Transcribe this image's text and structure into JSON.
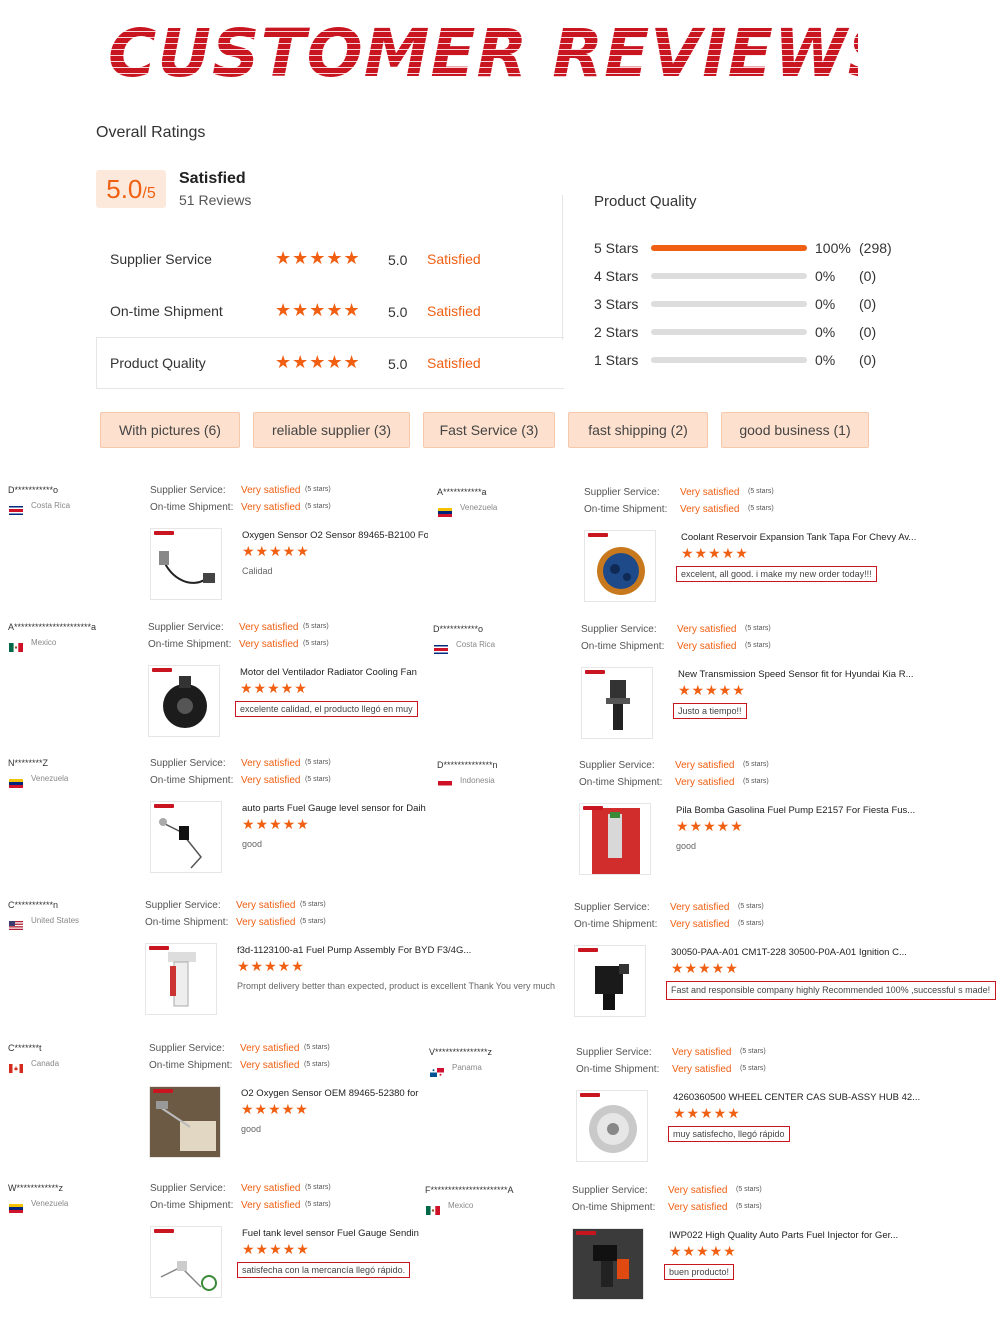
{
  "banner": "CUSTOMER REVIEWS",
  "overall": {
    "title": "Overall Ratings",
    "score_big": "5.0",
    "score_small": "/5",
    "label": "Satisfied",
    "reviews": "51 Reviews"
  },
  "ratings": [
    {
      "label": "Supplier Service",
      "stars": "★★★★★",
      "score": "5.0",
      "word": "Satisfied"
    },
    {
      "label": "On-time Shipment",
      "stars": "★★★★★",
      "score": "5.0",
      "word": "Satisfied"
    },
    {
      "label": "Product Quality",
      "stars": "★★★★★",
      "score": "5.0",
      "word": "Satisfied"
    }
  ],
  "product_quality": {
    "title": "Product Quality",
    "rows": [
      {
        "label": "5 Stars",
        "fraction": 1.0,
        "pct": "100%",
        "count": "(298)"
      },
      {
        "label": "4 Stars",
        "fraction": 0,
        "pct": "0%",
        "count": "(0)"
      },
      {
        "label": "3 Stars",
        "fraction": 0,
        "pct": "0%",
        "count": "(0)"
      },
      {
        "label": "2 Stars",
        "fraction": 0,
        "pct": "0%",
        "count": "(0)"
      },
      {
        "label": "1 Stars",
        "fraction": 0,
        "pct": "0%",
        "count": "(0)"
      }
    ]
  },
  "tags": [
    "With pictures (6)",
    "reliable supplier (3)",
    "Fast Service (3)",
    "fast shipping (2)",
    "good business (1)"
  ],
  "review_common": {
    "supplier_label": "Supplier Service:",
    "shipment_label": "On-time Shipment:",
    "very_satisfied": "Very satisfied",
    "five_stars": "(5 stars)",
    "stars": "★★★★★"
  },
  "reviews": [
    {
      "name": "D***********o",
      "country": "Costa Rica",
      "flag": "costa-rica",
      "product": "Oxygen Sensor O2 Sensor 89465-B2100 Fo",
      "comment": "Calidad",
      "boxed": false,
      "image": "oxygen-sensor"
    },
    {
      "name": "A***********a",
      "country": "Venezuela",
      "flag": "venezuela",
      "product": "Coolant Reservoir Expansion Tank Tapa For Chevy Av...",
      "comment": "excelent, all good. i make my new order today!!!",
      "boxed": true,
      "image": "reservoir-cap"
    },
    {
      "name": "A**********************a",
      "country": "Mexico",
      "flag": "mexico",
      "product": "Motor del Ventilador Radiator Cooling Fan",
      "comment": "excelente calidad, el producto llegó en muy",
      "boxed": true,
      "image": "fan-motor"
    },
    {
      "name": "D***********o",
      "country": "Costa Rica",
      "flag": "costa-rica",
      "product": "New Transmission Speed Sensor fit for Hyundai Kia R...",
      "comment": "Justo a tiempo!!",
      "boxed": true,
      "image": "speed-sensor"
    },
    {
      "name": "N********Z",
      "country": "Venezuela",
      "flag": "venezuela",
      "product": "auto parts Fuel Gauge level sensor for Daih",
      "comment": "good",
      "boxed": false,
      "image": "fuel-gauge"
    },
    {
      "name": "D**************n",
      "country": "Indonesia",
      "flag": "indonesia",
      "product": "Pila Bomba Gasolina Fuel Pump E2157 For Fiesta Fus...",
      "comment": "good",
      "boxed": false,
      "image": "fuel-pump"
    },
    {
      "name": "C***********n",
      "country": "United States",
      "flag": "usa",
      "product": "f3d-1123100-a1 Fuel Pump Assembly For BYD F3/4G...",
      "comment": "Prompt delivery better than expected, product is excellent Thank You very much",
      "boxed": false,
      "image": "pump-assembly"
    },
    {
      "name": "",
      "country": "",
      "flag": "",
      "product": "30050-PAA-A01 CM1T-228 30500-P0A-A01 Ignition C...",
      "comment": "Fast and responsible company highly Recommended 100% ,successful s made!",
      "boxed": true,
      "image": "ignition-coil"
    },
    {
      "name": "C*******t",
      "country": "Canada",
      "flag": "canada",
      "product": "O2 Oxygen Sensor OEM 89465-52380 for",
      "comment": "good",
      "boxed": false,
      "image": "o2-box"
    },
    {
      "name": "V***************z",
      "country": "Panama",
      "flag": "panama",
      "product": "4260360500 WHEEL CENTER CAS SUB-ASSY HUB 42...",
      "comment": "muy satisfecho, llegó rápido",
      "boxed": true,
      "image": "wheel-cap"
    },
    {
      "name": "W************z",
      "country": "Venezuela",
      "flag": "venezuela",
      "product": "Fuel tank level sensor Fuel Gauge Sendin",
      "comment": "satisfecha con la mercancía llegó rápido.",
      "boxed": true,
      "image": "tank-sensor"
    },
    {
      "name": "F**********************A",
      "country": "Mexico",
      "flag": "mexico",
      "product": "IWP022 High Quality Auto Parts Fuel Injector for Ger...",
      "comment": "buen producto!",
      "boxed": true,
      "image": "injector"
    }
  ]
}
